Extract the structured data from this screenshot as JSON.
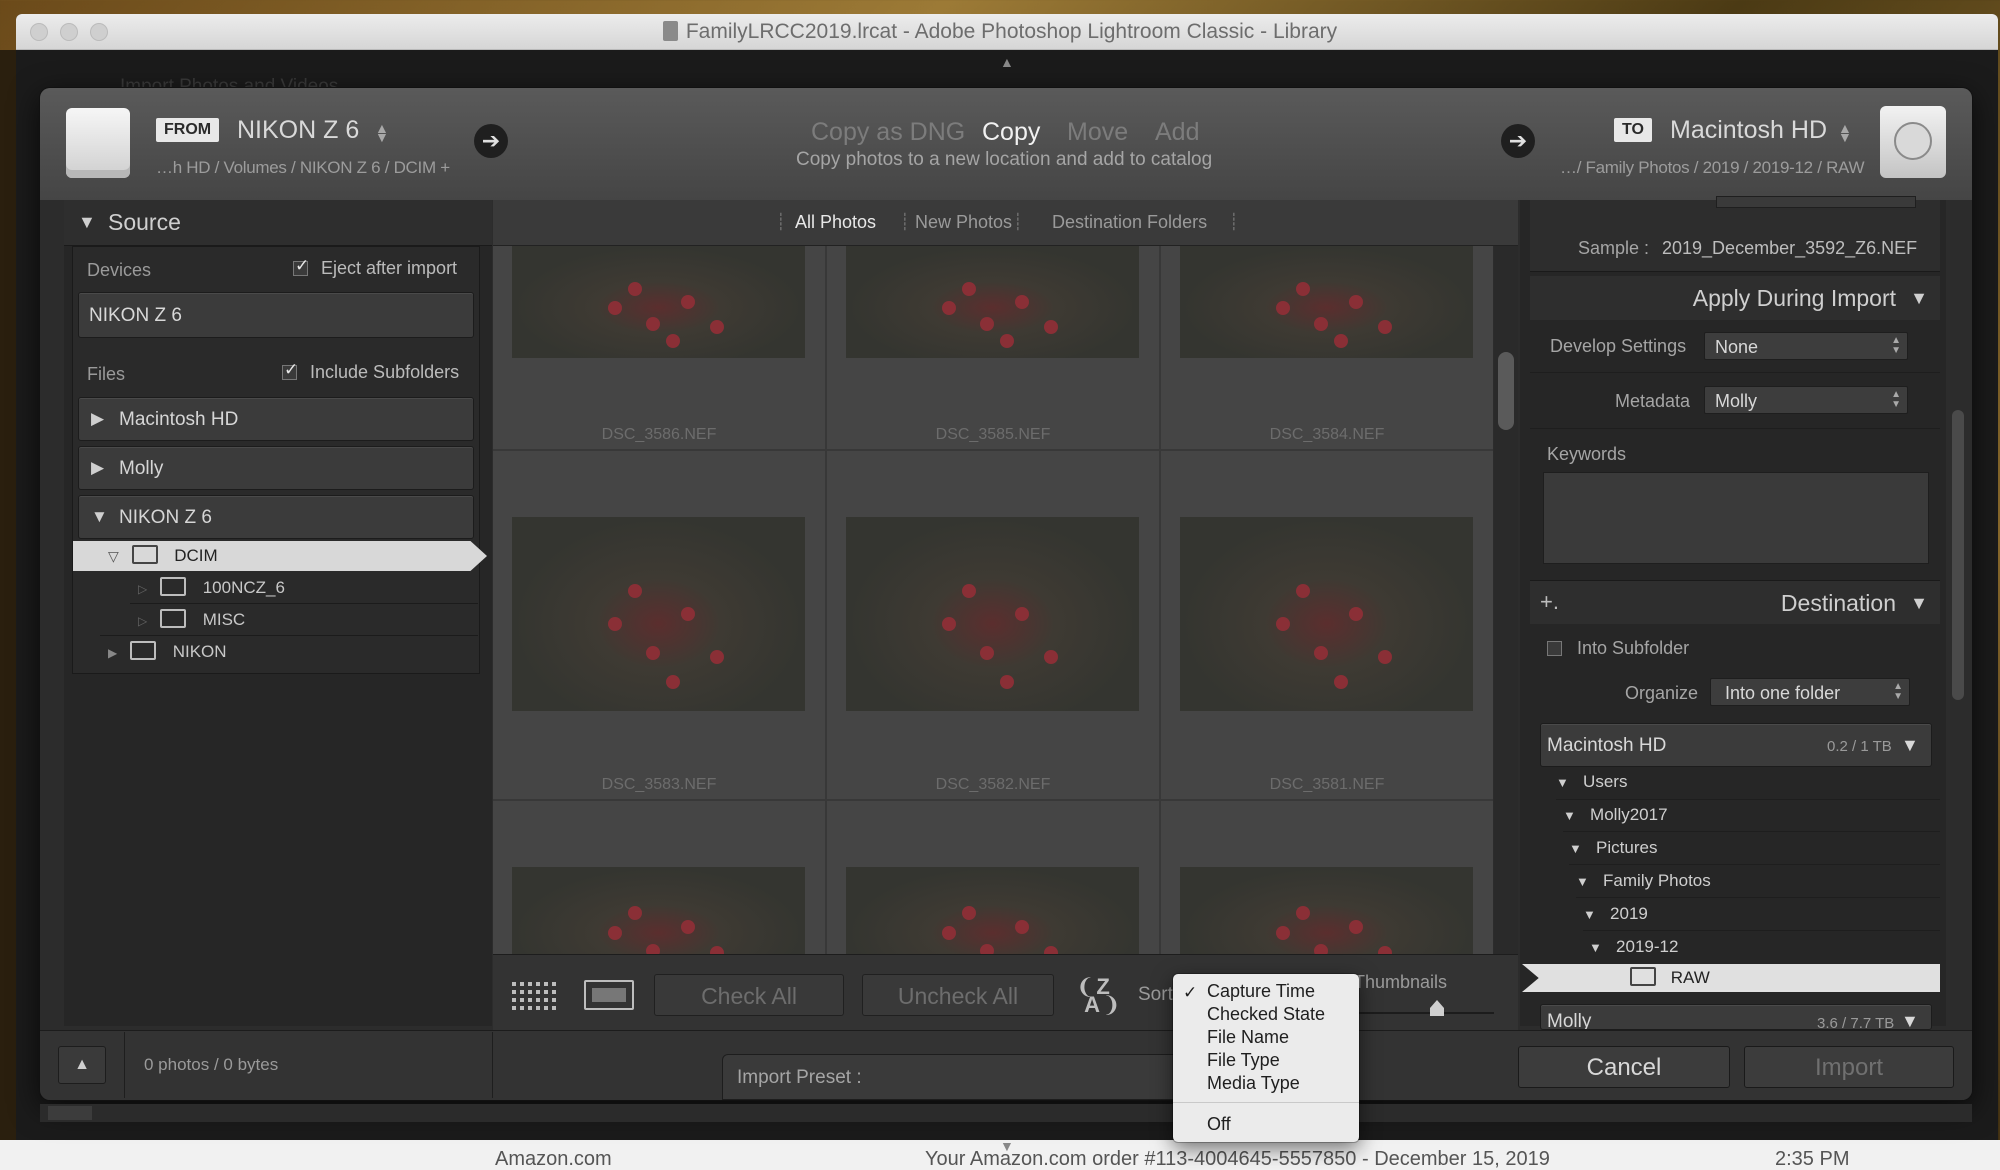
{
  "window": {
    "title": "FamilyLRCC2019.lrcat - Adobe Photoshop Lightroom Classic - Library",
    "background_text": "Import Photos and Videos",
    "bottom_text_left": "Amazon.com",
    "bottom_text_mid": "Your Amazon.com order #113-4004645-5557850 - December 15, 2019",
    "bottom_text_right": "2:35 PM"
  },
  "header": {
    "from_badge": "FROM",
    "from_name": "NIKON Z 6",
    "from_path": "…h HD / Volumes / NIKON Z 6  / DCIM +",
    "modes": [
      {
        "label": "Copy as DNG",
        "active": false
      },
      {
        "label": "Copy",
        "active": true
      },
      {
        "label": "Move",
        "active": false
      },
      {
        "label": "Add",
        "active": false
      }
    ],
    "mode_description": "Copy photos to a new location and add to catalog",
    "to_badge": "TO",
    "to_name": "Macintosh HD",
    "to_path": "…/ Family Photos / 2019 / 2019-12 / RAW"
  },
  "source": {
    "title": "Source",
    "devices_label": "Devices",
    "eject_label": "Eject after import",
    "eject_checked": true,
    "device_name": "NIKON Z 6",
    "files_label": "Files",
    "subfolders_label": "Include Subfolders",
    "subfolders_checked": true,
    "volumes": [
      "Macintosh HD",
      "Molly",
      "NIKON Z 6"
    ],
    "tree": [
      {
        "name": "DCIM",
        "selected": true
      },
      {
        "name": "100NCZ_6",
        "selected": false
      },
      {
        "name": "MISC",
        "selected": false
      },
      {
        "name": "NIKON",
        "selected": false
      }
    ]
  },
  "grid": {
    "tabs": [
      "All Photos",
      "New Photos",
      "Destination Folders"
    ],
    "active_tab": "All Photos",
    "photos": [
      "DSC_3586.NEF",
      "DSC_3585.NEF",
      "DSC_3584.NEF",
      "DSC_3583.NEF",
      "DSC_3582.NEF",
      "DSC_3581.NEF"
    ]
  },
  "toolbar": {
    "check_all": "Check All",
    "uncheck_all": "Uncheck All",
    "sort_label": "Sort",
    "thumbnails_label": "Thumbnails"
  },
  "sort_menu": {
    "items": [
      "Capture Time",
      "Checked State",
      "File Name",
      "File Type",
      "Media Type"
    ],
    "checked": "Capture Time",
    "off": "Off"
  },
  "right": {
    "sample_label": "Sample :",
    "sample_value": "2019_December_3592_Z6.NEF",
    "apply_title": "Apply During Import",
    "develop_label": "Develop Settings",
    "develop_value": "None",
    "metadata_label": "Metadata",
    "metadata_value": "Molly",
    "keywords_label": "Keywords",
    "destination_title": "Destination",
    "into_subfolder": "Into Subfolder",
    "organize_label": "Organize",
    "organize_value": "Into one folder",
    "volume_name": "Macintosh HD",
    "volume_usage": "0.2 / 1 TB",
    "tree": [
      "Users",
      "Molly2017",
      "Pictures",
      "Family Photos",
      "2019",
      "2019-12",
      "RAW"
    ],
    "volume2_name": "Molly",
    "volume2_usage": "3.6 / 7.7 TB"
  },
  "footer": {
    "status": "0 photos / 0 bytes",
    "preset_label": "Import Preset :",
    "cancel": "Cancel",
    "import": "Import"
  }
}
